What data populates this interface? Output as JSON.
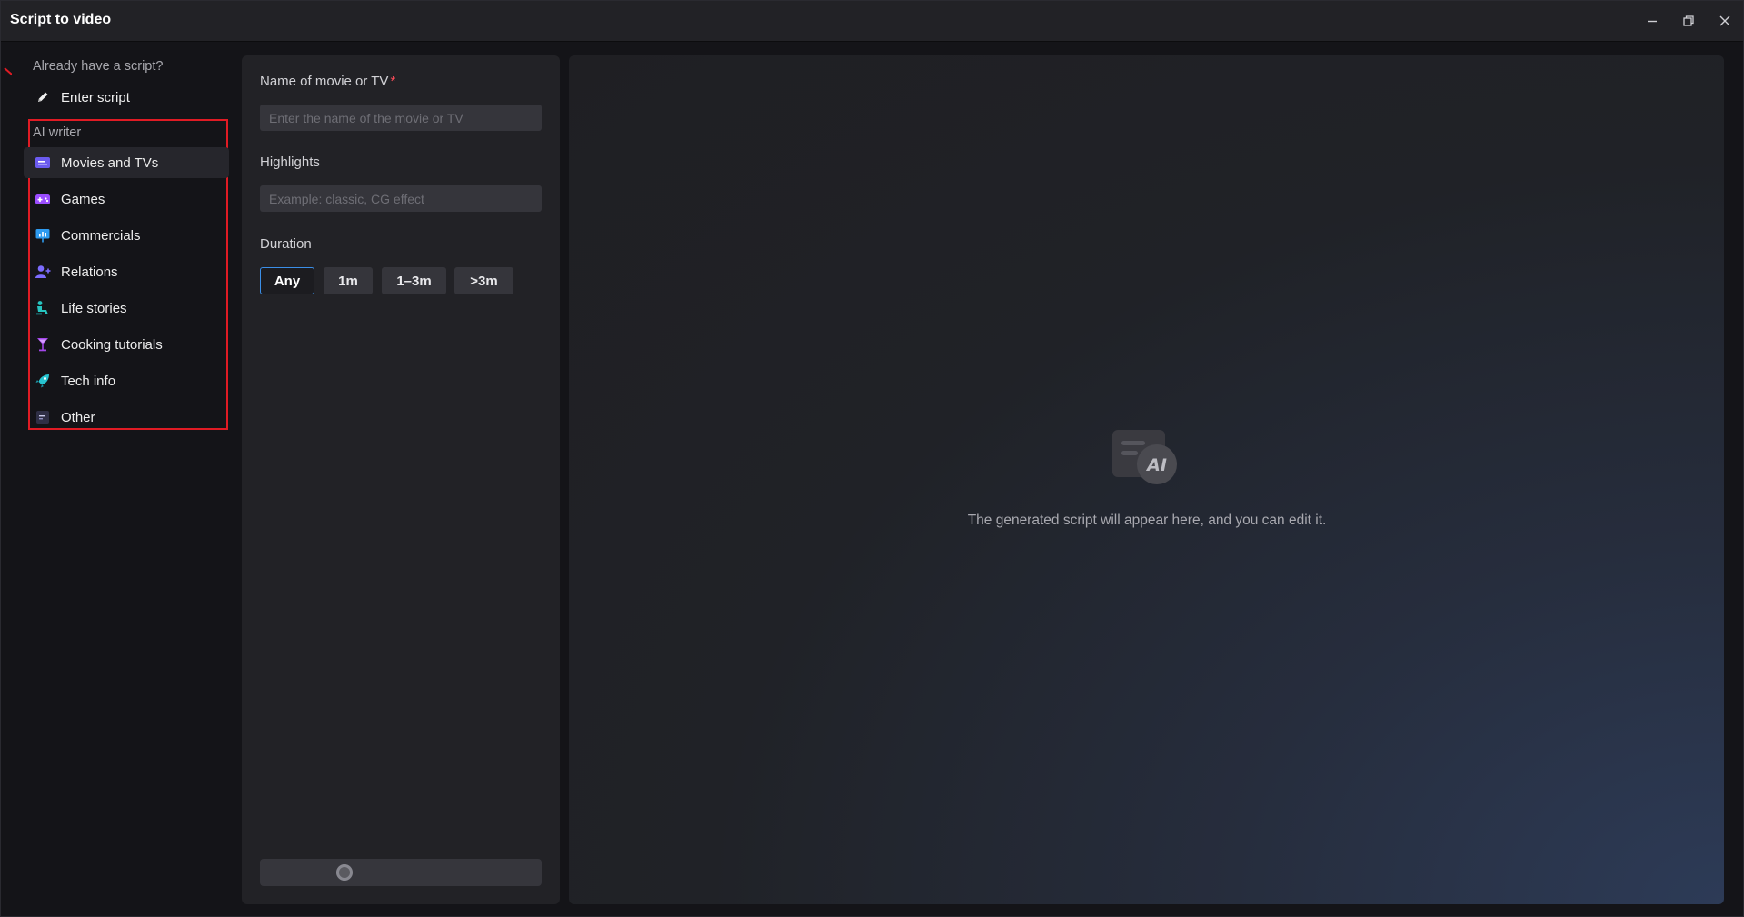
{
  "window": {
    "title": "Script to video",
    "controls": {
      "minimize": "minimize-icon",
      "restore": "restore-icon",
      "close": "close-icon"
    }
  },
  "sidebar": {
    "script_section_label": "Already have a script?",
    "enter_script_label": "Enter script",
    "ai_section_label": "AI writer",
    "categories": [
      {
        "label": "Movies and TVs",
        "icon": "film-icon",
        "active": true
      },
      {
        "label": "Games",
        "icon": "gamepad-icon"
      },
      {
        "label": "Commercials",
        "icon": "presentation-icon"
      },
      {
        "label": "Relations",
        "icon": "user-add-icon"
      },
      {
        "label": "Life stories",
        "icon": "seated-person-icon"
      },
      {
        "label": "Cooking tutorials",
        "icon": "cocktail-glass-icon"
      },
      {
        "label": "Tech info",
        "icon": "rocket-icon"
      },
      {
        "label": "Other",
        "icon": "list-icon"
      }
    ]
  },
  "form": {
    "name_label": "Name of movie or TV",
    "required_mark": "*",
    "name_placeholder": "Enter the name of the movie or TV",
    "name_value": "",
    "highlights_label": "Highlights",
    "highlights_placeholder": "Example: classic, CG effect",
    "highlights_value": "",
    "duration_label": "Duration",
    "duration_options": [
      "Any",
      "1m",
      "1–3m",
      ">3m"
    ],
    "duration_selected": "Any"
  },
  "preview": {
    "empty_icon": "ai-script-icon",
    "empty_text": "The generated script will appear here, and you can edit it."
  },
  "colors": {
    "accent": "#3b8fe8",
    "required": "#ff4d5a",
    "highlight_box": "#e01b24"
  }
}
